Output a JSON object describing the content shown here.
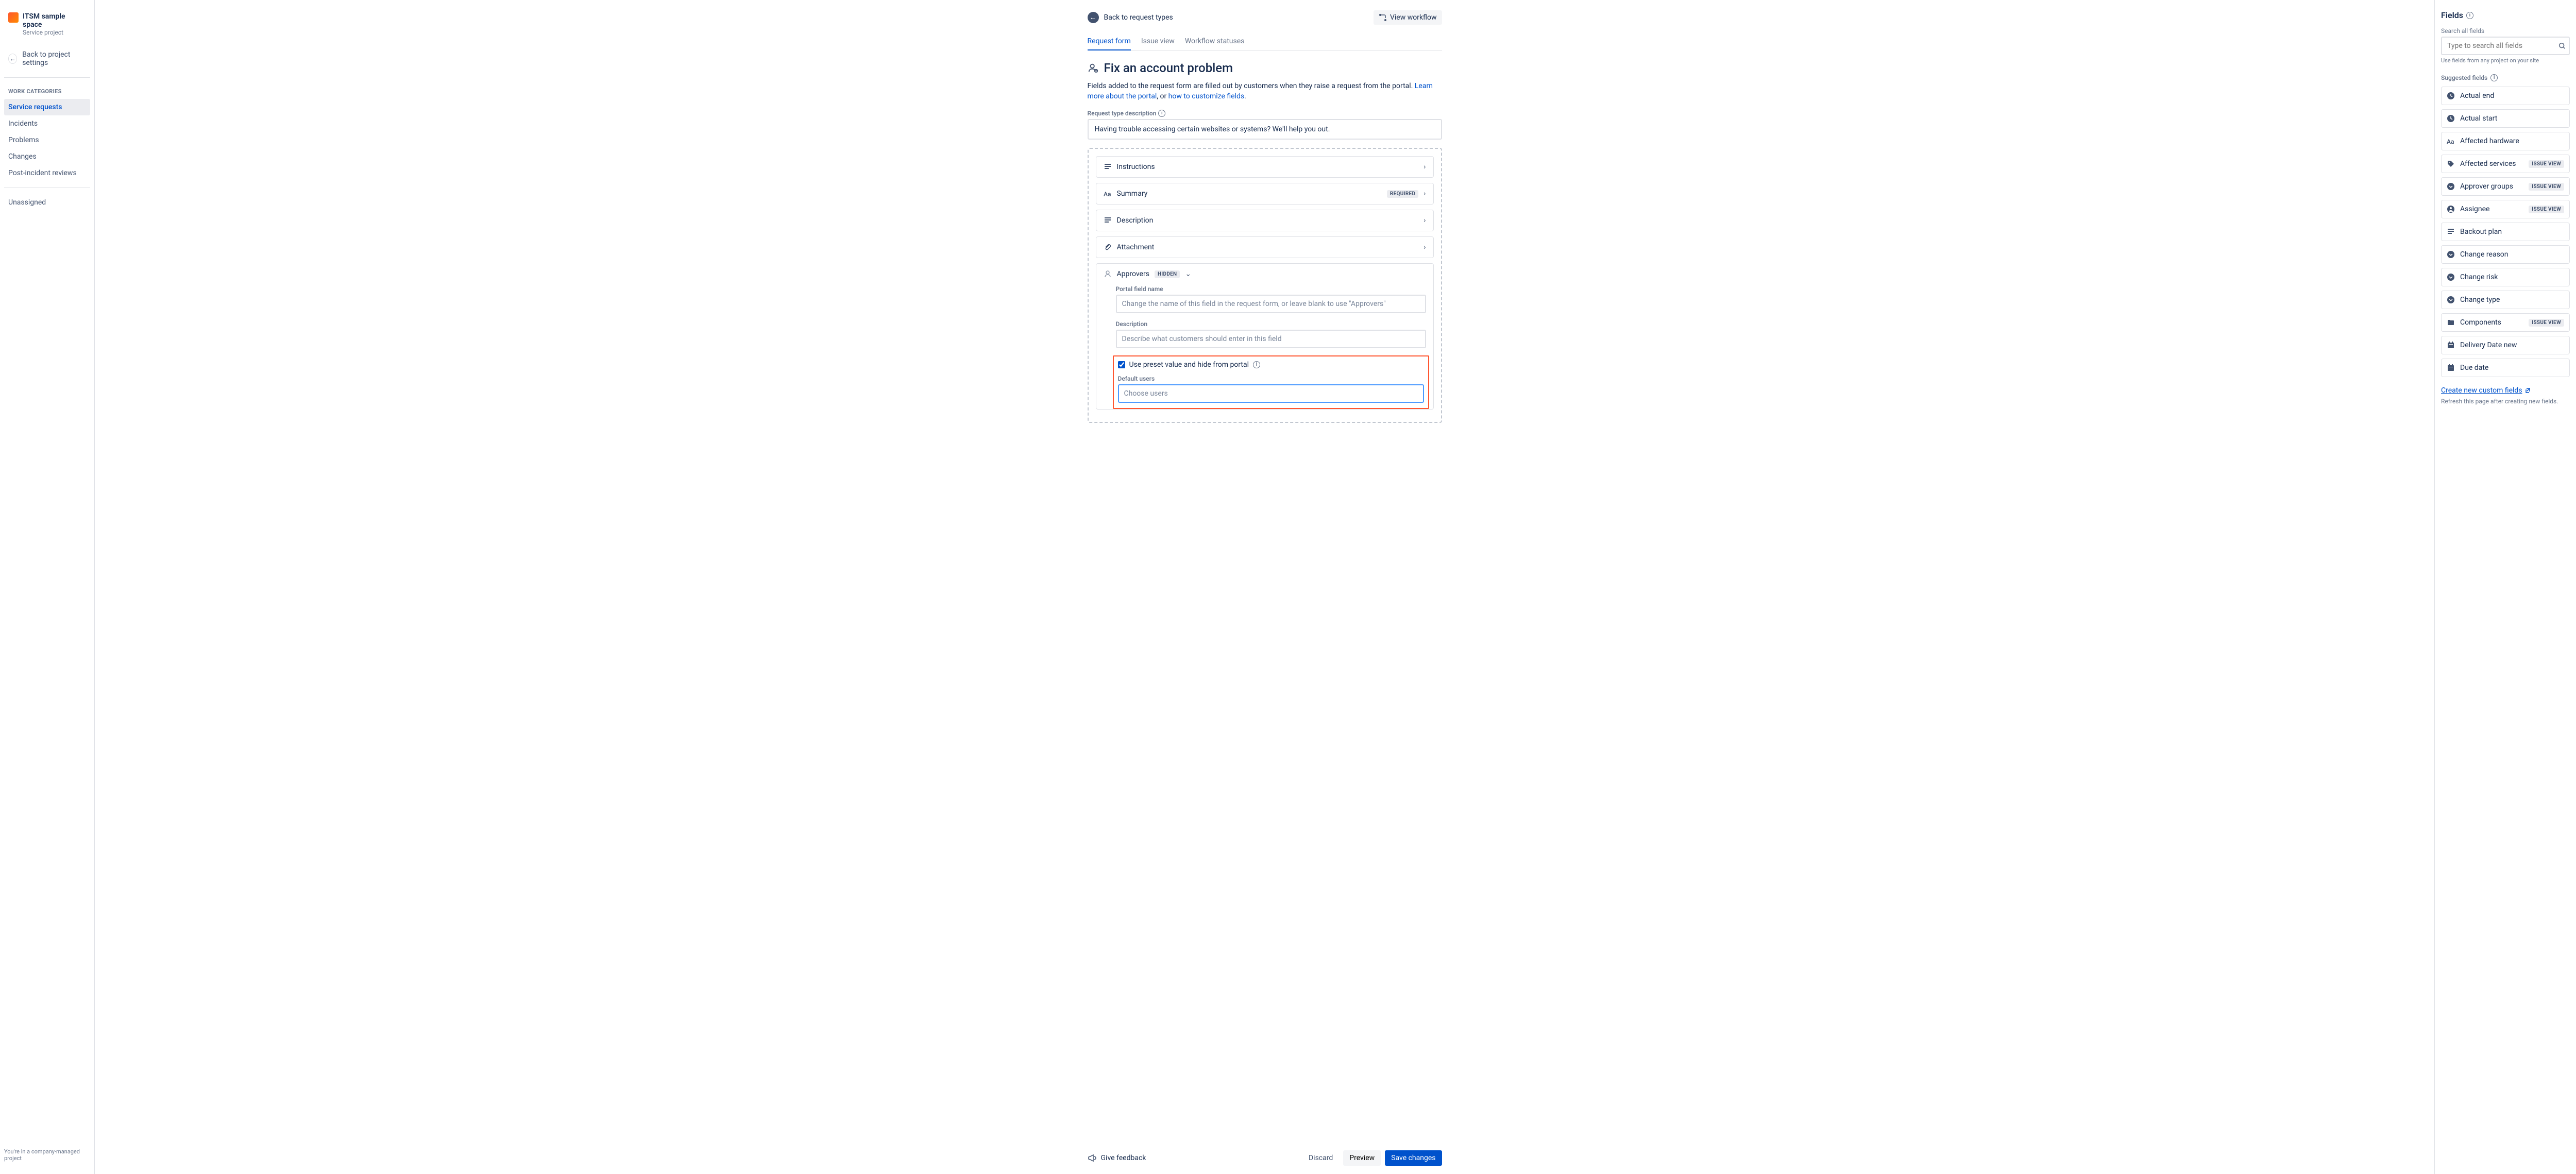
{
  "project": {
    "title": "ITSM sample space",
    "type": "Service project"
  },
  "sidebar": {
    "back_label": "Back to project settings",
    "section_label": "WORK CATEGORIES",
    "items": [
      {
        "label": "Service requests"
      },
      {
        "label": "Incidents"
      },
      {
        "label": "Problems"
      },
      {
        "label": "Changes"
      },
      {
        "label": "Post-incident reviews"
      }
    ],
    "unassigned": "Unassigned",
    "footer": "You're in a company-managed project"
  },
  "main": {
    "back_types": "Back to request types",
    "view_workflow": "View workflow",
    "tabs": [
      {
        "label": "Request form"
      },
      {
        "label": "Issue view"
      },
      {
        "label": "Workflow statuses"
      }
    ],
    "title": "Fix an account problem",
    "help_text_1": "Fields added to the request form are filled out by customers when they raise a request from the portal. ",
    "help_link_1": "Learn more about the portal",
    "help_text_2": ", or ",
    "help_link_2": "how to customize fields",
    "help_text_3": ".",
    "desc_label": "Request type description",
    "desc_value": "Having trouble accessing certain websites or systems? We'll help you out.",
    "rows": {
      "instructions": "Instructions",
      "summary": "Summary",
      "summary_badge": "REQUIRED",
      "description": "Description",
      "attachment": "Attachment",
      "approvers": "Approvers",
      "approvers_badge": "HIDDEN"
    },
    "expanded": {
      "portal_label": "Portal field name",
      "portal_placeholder": "Change the name of this field in the request form, or leave blank to use \"Approvers\"",
      "desc_label": "Description",
      "desc_placeholder": "Describe what customers should enter in this field",
      "checkbox_label": "Use preset value and hide from portal",
      "default_label": "Default users",
      "default_placeholder": "Choose users"
    },
    "actions": {
      "feedback": "Give feedback",
      "discard": "Discard",
      "preview": "Preview",
      "save": "Save changes"
    }
  },
  "panel": {
    "title": "Fields",
    "search_label": "Search all fields",
    "search_placeholder": "Type to search all fields",
    "hint": "Use fields from any project on your site",
    "suggest_label": "Suggested fields",
    "fields": [
      {
        "label": "Actual end",
        "icon": "clock"
      },
      {
        "label": "Actual start",
        "icon": "clock"
      },
      {
        "label": "Affected hardware",
        "icon": "text"
      },
      {
        "label": "Affected services",
        "icon": "tag",
        "badge": "ISSUE VIEW"
      },
      {
        "label": "Approver groups",
        "icon": "chevdown",
        "badge": "ISSUE VIEW"
      },
      {
        "label": "Assignee",
        "icon": "user",
        "badge": "ISSUE VIEW"
      },
      {
        "label": "Backout plan",
        "icon": "para"
      },
      {
        "label": "Change reason",
        "icon": "chevdown"
      },
      {
        "label": "Change risk",
        "icon": "chevdown"
      },
      {
        "label": "Change type",
        "icon": "chevdown"
      },
      {
        "label": "Components",
        "icon": "folder",
        "badge": "ISSUE VIEW"
      },
      {
        "label": "Delivery Date new",
        "icon": "cal"
      },
      {
        "label": "Due date",
        "icon": "cal"
      }
    ],
    "create_link": "Create new custom fields",
    "refresh": "Refresh this page after creating new fields."
  }
}
